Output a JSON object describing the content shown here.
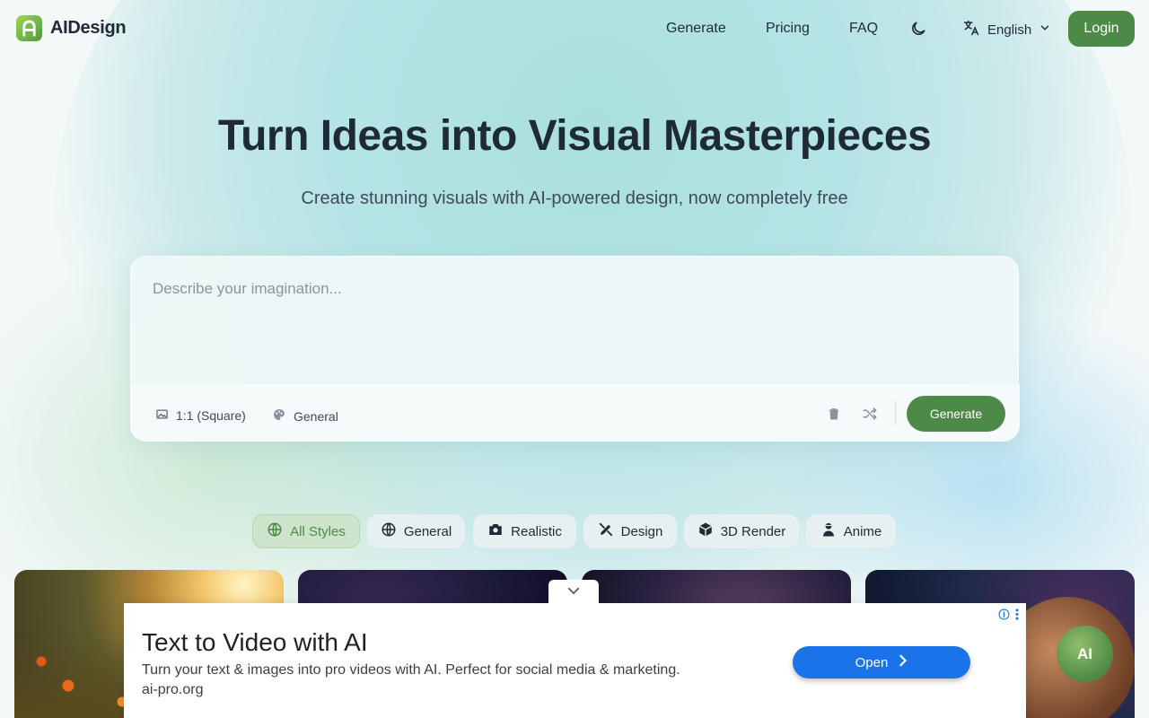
{
  "header": {
    "logo_text": "AIDesign",
    "nav": [
      "Generate",
      "Pricing",
      "FAQ"
    ],
    "language": "English",
    "login_label": "Login"
  },
  "hero": {
    "title": "Turn Ideas into Visual Masterpieces",
    "subtitle": "Create stunning visuals with AI-powered design, now completely free"
  },
  "prompt": {
    "placeholder": "Describe your imagination...",
    "aspect_ratio": "1:1 (Square)",
    "style": "General",
    "generate_label": "Generate"
  },
  "styles": {
    "items": [
      {
        "label": "All Styles",
        "icon": "globe-icon",
        "active": true
      },
      {
        "label": "General",
        "icon": "globe-icon",
        "active": false
      },
      {
        "label": "Realistic",
        "icon": "camera-icon",
        "active": false
      },
      {
        "label": "Design",
        "icon": "design-tools-icon",
        "active": false
      },
      {
        "label": "3D Render",
        "icon": "cube-icon",
        "active": false
      },
      {
        "label": "Anime",
        "icon": "anime-icon",
        "active": false
      }
    ]
  },
  "ad": {
    "title": "Text to Video with AI",
    "description": "Turn your text & images into pro videos with AI. Perfect for social media & marketing.",
    "url": "ai-pro.org",
    "open_label": "Open",
    "badge": "AI"
  },
  "colors": {
    "brand_green": "#4e8a47",
    "ad_button_blue": "#1a73e8"
  }
}
